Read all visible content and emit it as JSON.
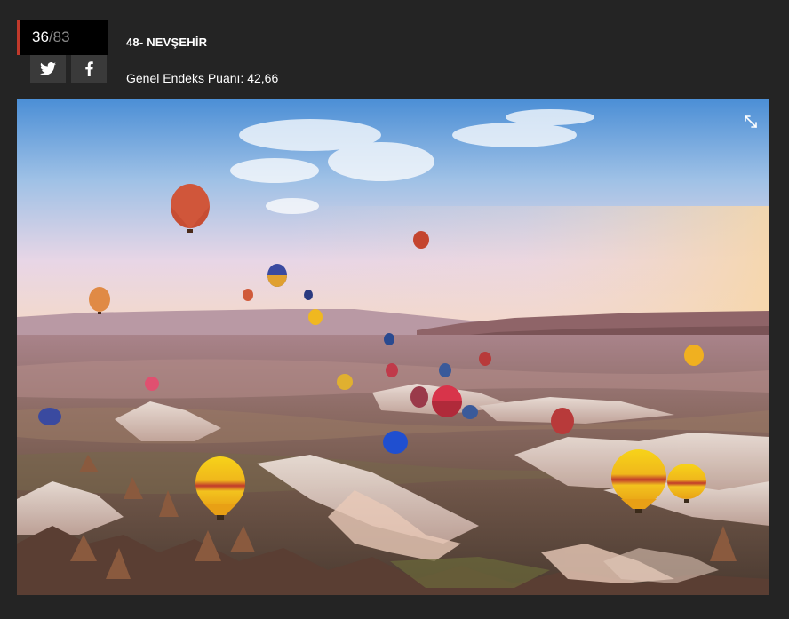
{
  "counter": {
    "current": "36",
    "separator": "/",
    "total": "83"
  },
  "share": {
    "twitter_icon": "twitter-icon",
    "facebook_icon": "facebook-icon"
  },
  "item": {
    "title": "48- NEVŞEHİR",
    "index_text": "Genel Endeks Puanı: 42,66"
  },
  "photo": {
    "subject": "hot-air-balloons-over-cappadocia",
    "expand_icon": "expand-icon"
  },
  "colors": {
    "background": "#242424",
    "accent": "#c0392b",
    "button": "#3a3a3a"
  }
}
